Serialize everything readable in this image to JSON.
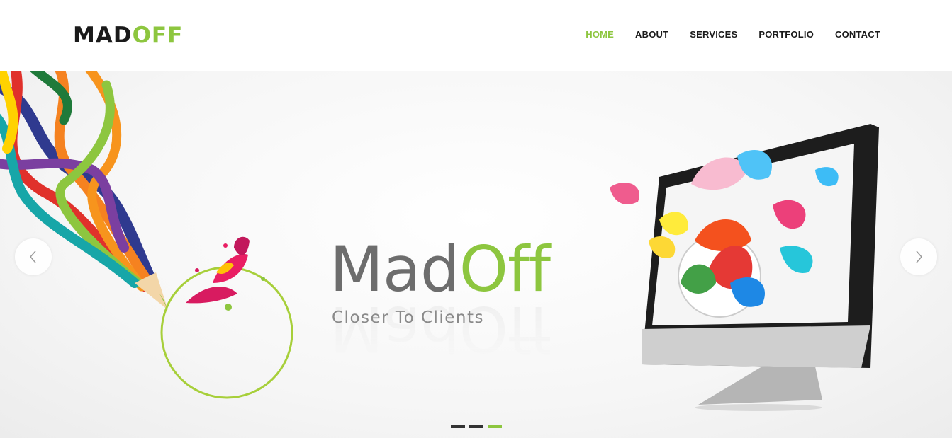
{
  "logo": {
    "part1": "MAD",
    "part2": "OFF"
  },
  "nav": {
    "items": [
      {
        "label": "HOME",
        "active": true
      },
      {
        "label": "ABOUT",
        "active": false
      },
      {
        "label": "SERVICES",
        "active": false
      },
      {
        "label": "PORTFOLIO",
        "active": false
      },
      {
        "label": "CONTACT",
        "active": false
      }
    ]
  },
  "slider": {
    "brand_part1": "Mad",
    "brand_part2": "Off",
    "tagline": "Closer To Clients",
    "prev_icon": "chevron-left-icon",
    "next_icon": "chevron-right-icon",
    "slide_count": 3,
    "active_slide": 3
  },
  "colors": {
    "accent": "#8dc63f",
    "dark": "#1a1a1a",
    "brand_gray": "#6d6d6d"
  }
}
